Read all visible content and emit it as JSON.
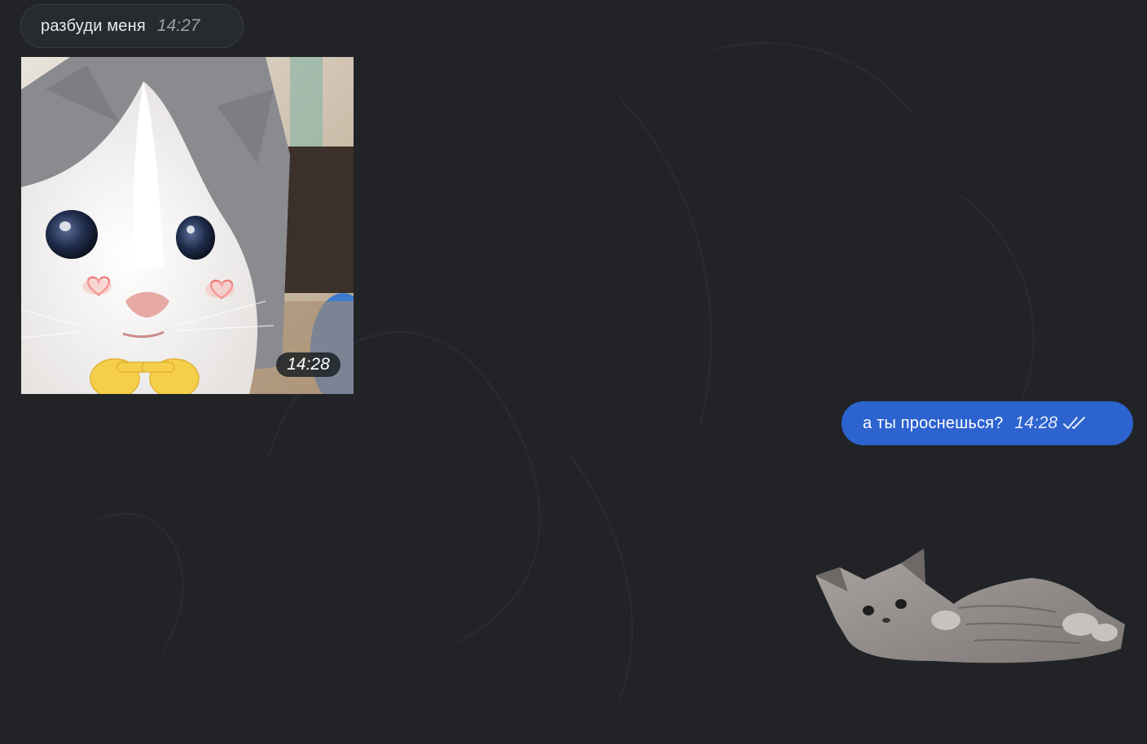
{
  "messages": [
    {
      "kind": "text",
      "direction": "incoming",
      "text": "разбуди меня",
      "time": "14:27"
    },
    {
      "kind": "photo",
      "direction": "incoming",
      "image": "kitten-pointing-fingers-photo",
      "time": "14:28"
    },
    {
      "kind": "text",
      "direction": "outgoing",
      "text": "а ты проснешься?",
      "time": "14:28",
      "status": "read",
      "status_icon": "double-check-icon"
    },
    {
      "kind": "sticker",
      "direction": "outgoing",
      "image": "kitten-lying-on-back-sticker"
    }
  ],
  "colors": {
    "background": "#212327",
    "incoming_bubble": "#272a2f",
    "outgoing_bubble": "#2c63cf"
  }
}
